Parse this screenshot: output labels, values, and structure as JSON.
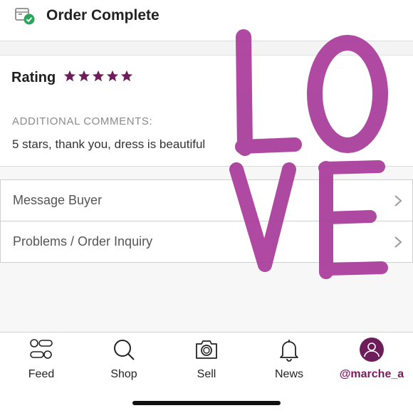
{
  "header": {
    "title": "Order Complete",
    "status_icon": "package-check-icon"
  },
  "review": {
    "rating_label": "Rating",
    "stars": 5,
    "star_color": "#6d1d5a",
    "comments_label": "ADDITIONAL COMMENTS:",
    "comments_text": "5 stars, thank you, dress is beautiful"
  },
  "menu": [
    {
      "label": "Message Buyer"
    },
    {
      "label": "Problems / Order Inquiry"
    }
  ],
  "overlay": {
    "text": "LOVE",
    "color": "#a83a9a"
  },
  "tabs": [
    {
      "label": "Feed",
      "icon": "feed-icon"
    },
    {
      "label": "Shop",
      "icon": "search-icon"
    },
    {
      "label": "Sell",
      "icon": "camera-icon"
    },
    {
      "label": "News",
      "icon": "bell-icon"
    },
    {
      "label": "@marche_a",
      "icon": "avatar-icon",
      "active": true
    }
  ],
  "accent": "#7a1a5e"
}
